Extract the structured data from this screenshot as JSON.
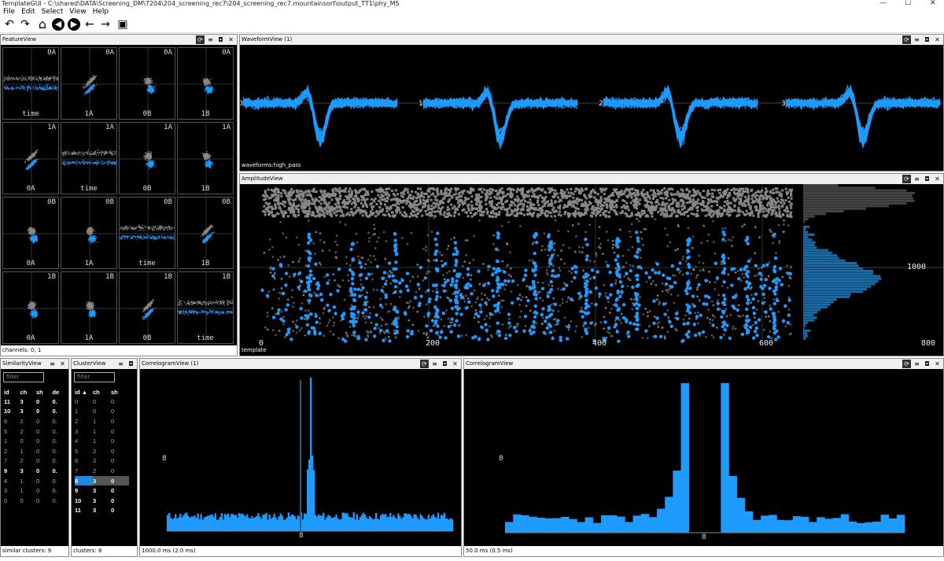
{
  "window": {
    "title": "TemplateGUI - C:\\shared\\DATA\\Screening_DM\\7204\\204_screening_rec7\\204_screening_rec7.mountainsort\\output_TT1\\phy_MS",
    "minimize": "—",
    "maximize": "☐",
    "close": "✕"
  },
  "menu": [
    "File",
    "Edit",
    "Select",
    "View",
    "Help"
  ],
  "icons": {
    "undo": "↶",
    "redo": "↷",
    "home": "⌂",
    "back_circle": "◀",
    "forward_circle": "▶",
    "left": "←",
    "right": "→",
    "save": "▣",
    "refresh": "⟳",
    "menu": "≡",
    "camera": "◘",
    "close": "✕"
  },
  "feature_view": {
    "title": "FeatureView",
    "footer": "channels: 0, 1",
    "cells": [
      {
        "tr": "0A",
        "bl": "time"
      },
      {
        "tr": "0A",
        "bl": "1A"
      },
      {
        "tr": "0A",
        "bl": "0B"
      },
      {
        "tr": "0A",
        "bl": "1B"
      },
      {
        "tr": "1A",
        "bl": "0A"
      },
      {
        "tr": "1A",
        "bl": "time"
      },
      {
        "tr": "1A",
        "bl": "0B"
      },
      {
        "tr": "1A",
        "bl": "1B"
      },
      {
        "tr": "0B",
        "bl": "0A"
      },
      {
        "tr": "0B",
        "bl": "1A"
      },
      {
        "tr": "0B",
        "bl": "time"
      },
      {
        "tr": "0B",
        "bl": "1B"
      },
      {
        "tr": "1B",
        "bl": "0A"
      },
      {
        "tr": "1B",
        "bl": "1A"
      },
      {
        "tr": "1B",
        "bl": "0B"
      },
      {
        "tr": "1B",
        "bl": "time"
      }
    ]
  },
  "waveform_view": {
    "title": "WaveformView (1)",
    "footer": "waveforms:high_pass",
    "channel_labels": [
      "0",
      "1",
      "2",
      "3"
    ]
  },
  "amplitude_view": {
    "title": "AmplitudeView",
    "footer": "template",
    "x_ticks": [
      "0",
      "200",
      "400",
      "600"
    ],
    "y_tick": "1000",
    "hist_tick": "800"
  },
  "similarity_view": {
    "title": "SimilarityView",
    "filter_placeholder": "filter",
    "footer": "similar clusters: 9",
    "columns": [
      "id",
      "ch",
      "sh",
      "de"
    ],
    "rows": [
      [
        "11",
        "3",
        "0",
        "0."
      ],
      [
        "10",
        "3",
        "0",
        "0."
      ],
      [
        "6",
        "2",
        "0",
        "0."
      ],
      [
        "5",
        "2",
        "0",
        "0."
      ],
      [
        "1",
        "0",
        "0",
        "0."
      ],
      [
        "2",
        "1",
        "0",
        "0."
      ],
      [
        "7",
        "2",
        "0",
        "0."
      ],
      [
        "9",
        "3",
        "0",
        "0."
      ],
      [
        "4",
        "1",
        "0",
        "0."
      ],
      [
        "3",
        "1",
        "0",
        "0."
      ],
      [
        "0",
        "0",
        "0",
        "0."
      ]
    ],
    "styles": [
      "bold",
      "bold",
      "green",
      "green",
      "green",
      "green",
      "green",
      "bold",
      "green",
      "grey",
      "grey"
    ]
  },
  "cluster_view": {
    "title": "ClusterView",
    "filter_placeholder": "filter",
    "footer": "clusters: 8",
    "columns": [
      "id ▲",
      "ch",
      "sh"
    ],
    "rows": [
      [
        "0",
        "0",
        "0"
      ],
      [
        "1",
        "0",
        "0"
      ],
      [
        "2",
        "1",
        "0"
      ],
      [
        "3",
        "1",
        "0"
      ],
      [
        "4",
        "1",
        "0"
      ],
      [
        "5",
        "2",
        "0"
      ],
      [
        "6",
        "2",
        "0"
      ],
      [
        "7",
        "2",
        "0"
      ],
      [
        "8",
        "3",
        "0"
      ],
      [
        "9",
        "3",
        "0"
      ],
      [
        "10",
        "3",
        "0"
      ],
      [
        "11",
        "3",
        "0"
      ]
    ],
    "styles": [
      "grey",
      "green",
      "green",
      "grey",
      "green",
      "green",
      "green",
      "grey",
      "selrow",
      "bold",
      "bold",
      "bold"
    ]
  },
  "correlogram_1": {
    "title": "CorrelogramView (1)",
    "footer": "1000.0 ms (2.0 ms)",
    "cluster_label": "8",
    "axis_label": "8"
  },
  "correlogram_2": {
    "title": "CorrelogramView",
    "footer": "50.0 ms (0.5 ms)",
    "cluster_label": "8",
    "axis_label": "8"
  },
  "colors": {
    "selected_blue": "#1e9bff",
    "background_grey": "#888888",
    "green_text": "#7bd148",
    "panel_bg": "#000000"
  }
}
